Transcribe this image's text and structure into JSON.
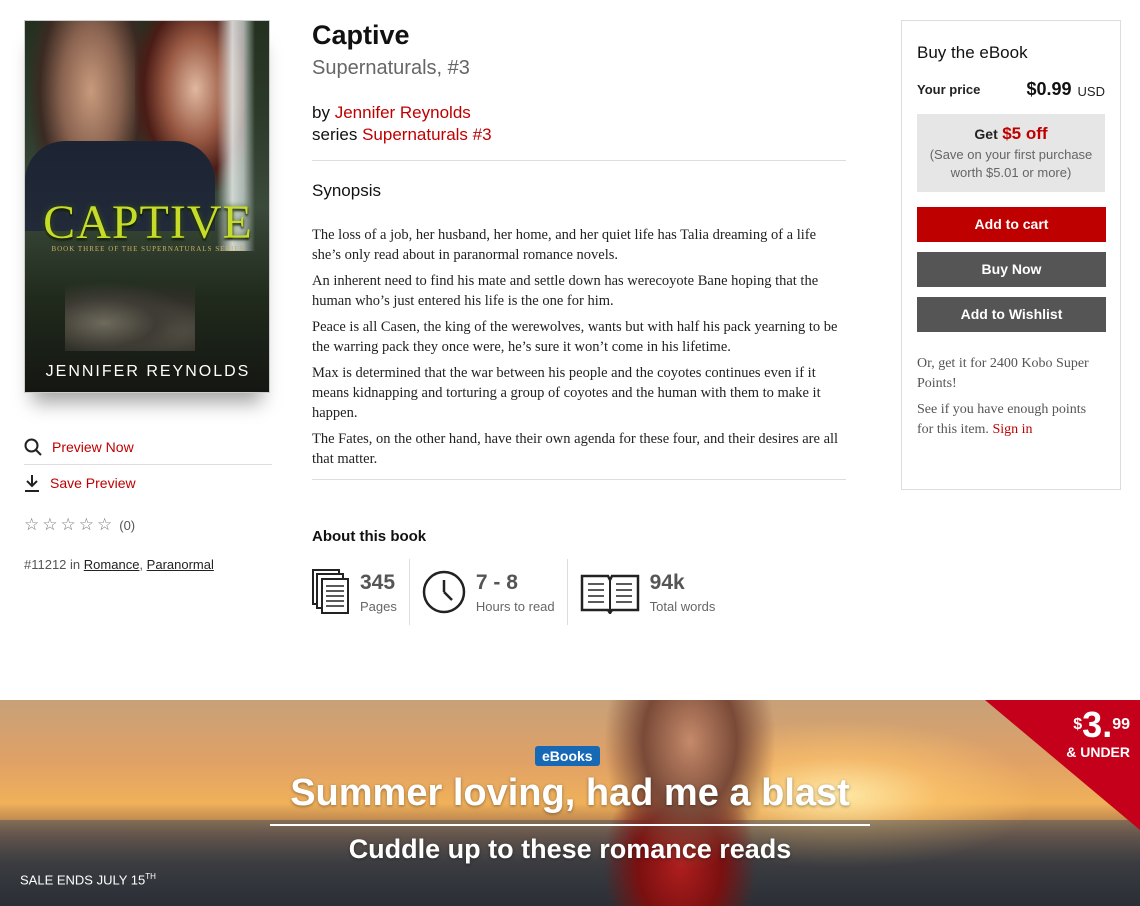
{
  "cover": {
    "title_art": "CAPTIVE",
    "subtitle_art": "BOOK THREE OF THE SUPERNATURALS SERIES",
    "author_art": "JENNIFER REYNOLDS"
  },
  "left": {
    "preview_now": "Preview Now",
    "save_preview": "Save Preview",
    "rating_count": "(0)",
    "rank_prefix": "#11212 in",
    "categories": [
      "Romance",
      "Paranormal"
    ],
    "category_sep": ","
  },
  "book": {
    "title": "Captive",
    "series_sub": "Supernaturals, #3",
    "by_label": "by",
    "author": "Jennifer Reynolds",
    "series_label": "series",
    "series_link": "Supernaturals #3"
  },
  "synopsis": {
    "heading": "Synopsis",
    "paragraphs": [
      "The loss of a job, her husband, her home, and her quiet life has Talia dreaming of a life she’s only read about in paranormal romance novels.",
      "An inherent need to find his mate and settle down has werecoyote Bane hoping that the human who’s just entered his life is the one for him.",
      "Peace is all Casen, the king of the werewolves, wants but with half his pack yearning to be the warring pack they once were, he’s sure it won’t come in his lifetime.",
      "Max is determined that the war between his people and the coyotes continues even if it means kidnapping and torturing a group of coyotes and the human with them to make it happen.",
      "The Fates, on the other hand, have their own agenda for these four, and their desires are all that matter."
    ]
  },
  "about": {
    "heading": "About this book",
    "stats": [
      {
        "value": "345",
        "label": "Pages",
        "icon": "pages-icon"
      },
      {
        "value": "7 - 8",
        "label": "Hours to read",
        "icon": "clock-icon"
      },
      {
        "value": "94k",
        "label": "Total words",
        "icon": "open-book-icon"
      }
    ]
  },
  "buy": {
    "title": "Buy the eBook",
    "price_label": "Your price",
    "price": "$0.99",
    "currency": "USD",
    "promo_get": "Get",
    "promo_off": "$5 off",
    "promo_note": "(Save on your first purchase worth $5.01 or more)",
    "add_to_cart": "Add to cart",
    "buy_now": "Buy Now",
    "add_to_wishlist": "Add to Wishlist",
    "points_note": "Or, get it for 2400 Kobo Super Points!",
    "points_check": "See if you have enough points for this item.",
    "sign_in": "Sign in",
    "colors": {
      "accent": "#bf0000",
      "button_gray": "#555555"
    }
  },
  "banner": {
    "pill": "eBooks",
    "headline": "Summer loving, had me a blast",
    "subhead": "Cuddle up to these romance reads",
    "sale_ends": "SALE ENDS JULY 15",
    "sale_ends_sup": "TH",
    "corner_currency": "$",
    "corner_amount": "3.",
    "corner_cents": "99",
    "corner_under": "& UNDER"
  }
}
